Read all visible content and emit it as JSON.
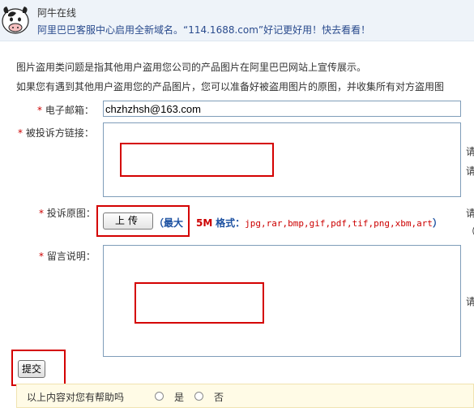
{
  "banner": {
    "title": "阿牛在线",
    "message": "阿里巴巴客服中心启用全新域名。“114.1688.com”好记更好用！快去看看！"
  },
  "intro": {
    "line1": "图片盗用类问题是指其他用户盗用您公司的产品图片在阿里巴巴网站上宣传展示。",
    "line2": "如果您有遇到其他用户盗用您的产品图片，您可以准备好被盗用图片的原图，并收集所有对方盗用图"
  },
  "form": {
    "required_mark": "*",
    "email_label": "电子邮箱：",
    "email_value": "chzhzhsh@163.com",
    "link_label": "被投诉方链接：",
    "image_label": "投诉原图：",
    "upload_button": "上传",
    "format_open": "（",
    "format_max": "最大",
    "format_size": "5M",
    "format_label": "格式：",
    "format_list": "jpg,rar,bmp,gif,pdf,tif,png,xbm,art",
    "format_close": "）",
    "message_label": "留言说明：",
    "hint_char": "请",
    "hint_paren": "（",
    "submit_button": "提交"
  },
  "feedback": {
    "question": "以上内容对您有帮助吗",
    "yes": "是",
    "no": "否"
  },
  "colors": {
    "highlight_box": "#d40000",
    "link_blue": "#1a4fa0",
    "required_red": "#cc0000"
  }
}
